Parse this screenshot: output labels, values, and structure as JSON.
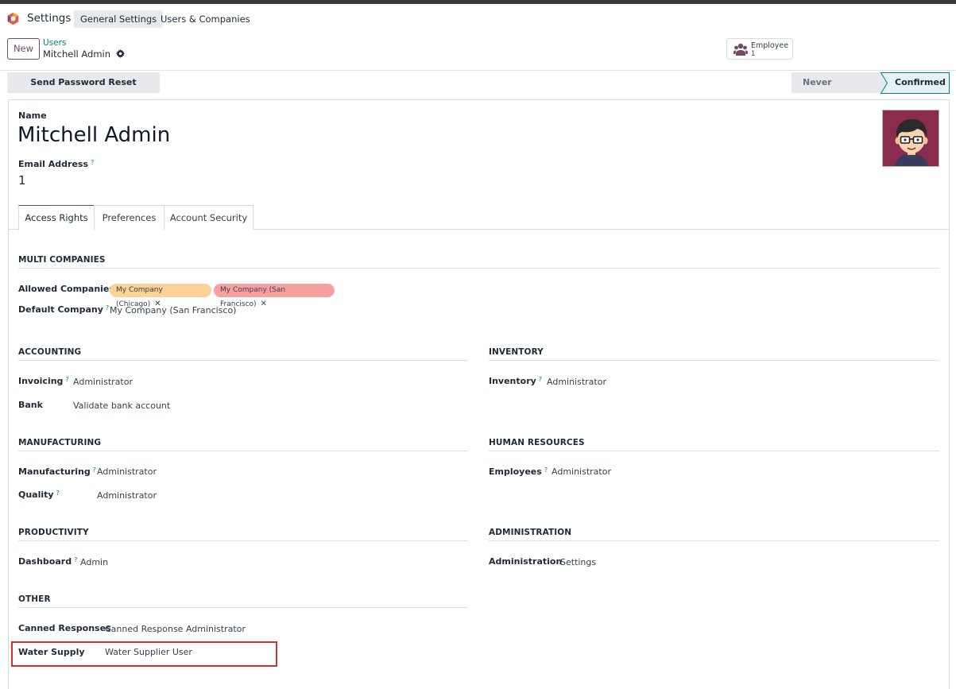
{
  "navbar": {
    "app_title": "Settings",
    "menu": [
      "General Settings",
      "Users & Companies"
    ]
  },
  "control_panel": {
    "new_label": "New",
    "breadcrumb_parent": "Users",
    "breadcrumb_current": "Mitchell Admin",
    "smart_button": {
      "label": "Employee",
      "value": "1"
    }
  },
  "statusbar": {
    "action_button": "Send Password Reset Instructions",
    "states": [
      "Never Connected",
      "Confirmed"
    ],
    "active_state": "Confirmed"
  },
  "record": {
    "name_label": "Name",
    "name": "Mitchell Admin",
    "email_label": "Email Address",
    "email_help": "?",
    "email": "1"
  },
  "tabs": [
    "Access Rights",
    "Preferences",
    "Account Security"
  ],
  "multi_companies": {
    "title": "MULTI COMPANIES",
    "allowed_label": "Allowed Companies",
    "allowed": [
      "My Company (Chicago)",
      "My Company (San Francisco)"
    ],
    "default_label": "Default Company",
    "default_value": "My Company (San Francisco)"
  },
  "accounting": {
    "title": "ACCOUNTING",
    "invoicing_label": "Invoicing",
    "invoicing": "Administrator",
    "bank_label": "Bank",
    "bank": "Validate bank account"
  },
  "inventory": {
    "title": "INVENTORY",
    "inventory_label": "Inventory",
    "inventory": "Administrator"
  },
  "manufacturing": {
    "title": "MANUFACTURING",
    "manufacturing_label": "Manufacturing",
    "manufacturing": "Administrator",
    "quality_label": "Quality",
    "quality": "Administrator"
  },
  "human_resources": {
    "title": "HUMAN RESOURCES",
    "employees_label": "Employees",
    "employees": "Administrator"
  },
  "productivity": {
    "title": "PRODUCTIVITY",
    "dashboard_label": "Dashboard",
    "dashboard": "Admin"
  },
  "administration": {
    "title": "ADMINISTRATION",
    "administration_label": "Administration",
    "administration": "Settings"
  },
  "other": {
    "title": "OTHER",
    "canned_label": "Canned Responses",
    "canned": "Canned Response Administrator",
    "water_label": "Water Supply",
    "water": "Water Supplier User"
  },
  "colors": {
    "brand": "#714b67",
    "link": "#017e84",
    "tag_chicago": "#fcd297",
    "tag_sf": "#f8a0a0",
    "highlight": "#d32f2f"
  },
  "icons": [
    "odoo-logo-icon",
    "gear-icon",
    "users-icon",
    "tag-remove-icon",
    "help-icon"
  ]
}
